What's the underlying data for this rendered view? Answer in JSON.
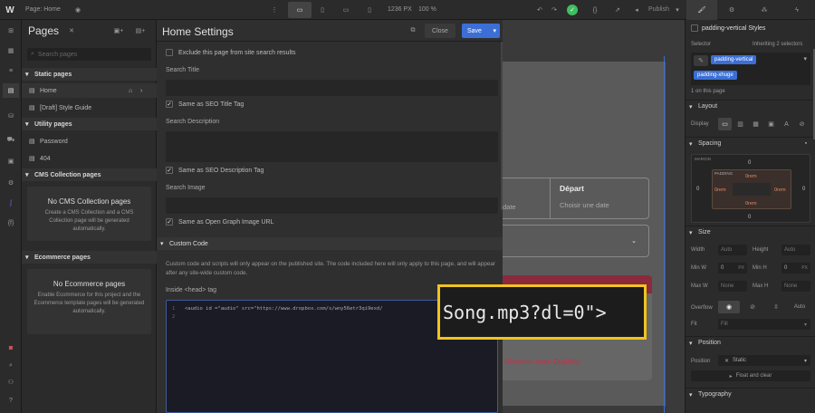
{
  "topbar": {
    "logo": "W",
    "page_label": "Page: Home",
    "width": "1236 PX",
    "zoom": "100 %",
    "publish": "Publish"
  },
  "pages_panel": {
    "title": "Pages",
    "search_placeholder": "Search pages",
    "static_header": "Static pages",
    "home": "Home",
    "style_guide": "[Draft] Style Guide",
    "utility_header": "Utility pages",
    "password": "Password",
    "p404": "404",
    "cms_header": "CMS Collection pages",
    "cms_empty_title": "No CMS Collection pages",
    "cms_empty_desc": "Create a CMS Collection and a CMS Collection page will be generated automatically.",
    "ecom_header": "Ecommerce pages",
    "ecom_empty_title": "No Ecommerce pages",
    "ecom_empty_desc": "Enable Ecommerce for this project and the Ecommerce template pages will be generated automatically."
  },
  "settings": {
    "title": "Home Settings",
    "close": "Close",
    "save": "Save",
    "exclude": "Exclude this page from site search results",
    "search_title": "Search Title",
    "same_seo_title": "Same as SEO Title Tag",
    "search_desc": "Search Description",
    "same_seo_desc": "Same as SEO Description Tag",
    "search_image": "Search Image",
    "same_og": "Same as Open Graph Image URL",
    "custom_code": "Custom Code",
    "custom_code_desc": "Custom code and scripts will only appear on the published site. The code included here will only apply to this page, and will appear after any site-wide custom code.",
    "head_tag": "Inside <head> tag",
    "line1": "1",
    "line2": "2",
    "code": "<audio id =\"audio\" src=\"https://www.dropbox.com/s/wny56etr3qi9exd/"
  },
  "overlay": {
    "text": "Song.mp3?dl=0\">"
  },
  "canvas": {
    "depart": "Départ",
    "choisir": "Choisir une date",
    "date_frag": "date",
    "cta": "Discuter avec Digidop"
  },
  "right": {
    "selector_name": "padding-vertical Styles",
    "selector": "Selector",
    "inheriting": "Inheriting 2 selectors",
    "class1": "padding-vertical",
    "class2": "padding-xhuge",
    "on_page": "1 on this page",
    "layout": "Layout",
    "display": "Display",
    "spacing": "Spacing",
    "margin": "MARGIN",
    "padding": "PADDING",
    "m_top": "0",
    "m_left": "0",
    "m_right": "0",
    "m_bottom": "0",
    "p_top": "0rem",
    "p_left": "0rem",
    "p_right": "0rem",
    "p_bottom": "0rem",
    "size": "Size",
    "width": "Width",
    "height": "Height",
    "auto": "Auto",
    "minw": "Min W",
    "minh": "Min H",
    "zero": "0",
    "px": "PX",
    "maxw": "Max W",
    "maxh": "Max H",
    "none": "None",
    "overflow": "Overflow",
    "overflow_auto": "Auto",
    "fit": "Fit",
    "fill": "Fill",
    "position": "Position",
    "position_label": "Position",
    "static": "Static",
    "float": "Float and clear",
    "typography": "Typography"
  }
}
